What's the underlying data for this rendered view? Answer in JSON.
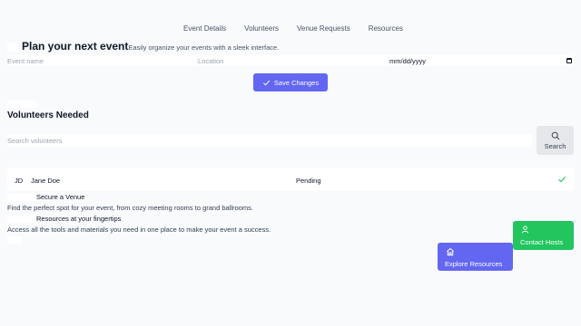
{
  "nav": {
    "items": [
      "Event Details",
      "Volunteers",
      "Venue Requests",
      "Resources"
    ]
  },
  "event": {
    "title": "Plan your next event",
    "subtitle": "Easily organize your events with a sleek interface.",
    "name_placeholder": "Event name",
    "location_placeholder": "Location",
    "date_value": "mm/dd/yyyy",
    "save_label": "Save Changes"
  },
  "volunteers": {
    "heading": "Volunteers Needed",
    "search_placeholder": "Search volunteers",
    "search_label": "Search",
    "rows": [
      {
        "initials": "JD",
        "name": "Jane Doe",
        "status": "Pending"
      }
    ]
  },
  "cards": [
    {
      "title": "Secure a Venue",
      "description": "Find the perfect spot for your event, from cozy meeting rooms to grand ballrooms."
    },
    {
      "title": "Resources at your fingertips",
      "description": "Access all the tools and materials you need in one place to make your event a success."
    }
  ],
  "actions": {
    "contact_label": "Contact Hosts",
    "explore_label": "Explore Resources"
  },
  "colors": {
    "primary": "#6366f1",
    "success": "#22c55e",
    "background": "#f8fafc"
  },
  "icons": [
    "check-icon",
    "search-icon",
    "user-icon",
    "home-icon",
    "calendar-icon"
  ]
}
